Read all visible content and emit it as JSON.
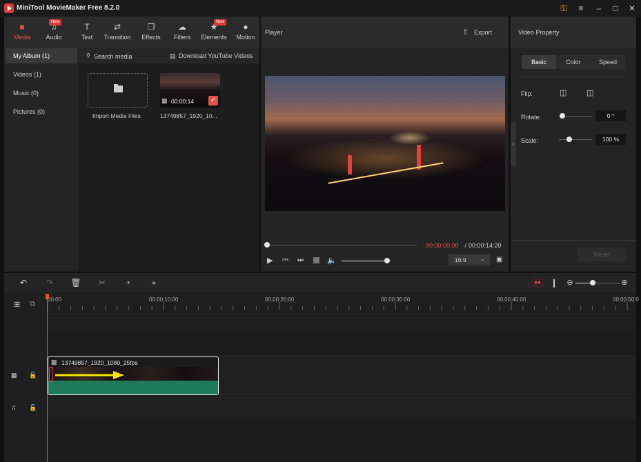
{
  "app": {
    "title": "MiniTool MovieMaker Free 8.2.0"
  },
  "toolbar": {
    "new_badge": "New",
    "tools": [
      {
        "name": "media",
        "label": "Media"
      },
      {
        "name": "audio",
        "label": "Audio"
      },
      {
        "name": "text",
        "label": "Text"
      },
      {
        "name": "transition",
        "label": "Transition"
      },
      {
        "name": "effects",
        "label": "Effects"
      },
      {
        "name": "filters",
        "label": "Filters"
      },
      {
        "name": "elements",
        "label": "Elements"
      },
      {
        "name": "motion",
        "label": "Motion"
      }
    ]
  },
  "album": {
    "items": [
      {
        "label": "My Album (1)"
      },
      {
        "label": "Videos (1)"
      },
      {
        "label": "Music (0)"
      },
      {
        "label": "Pictures (0)"
      }
    ]
  },
  "media": {
    "search_label": "Search media",
    "download_label": "Download YouTube Videos",
    "import_label": "Import Media Files",
    "clip_duration": "00:00:14",
    "clip_name": "13749857_1920_10..."
  },
  "player": {
    "title": "Player",
    "export_label": "Export",
    "current_time": "00:00:00:00",
    "separator": " / ",
    "total_time": "00:00:14:20",
    "aspect_ratio": "16:9",
    "progress_fraction": 0,
    "volume_fraction": 1.0
  },
  "property": {
    "title": "Video Property",
    "tabs": [
      "Basic",
      "Color",
      "Speed"
    ],
    "flip_label": "Flip:",
    "rotate_label": "Rotate:",
    "rotate_value": "0 °",
    "scale_label": "Scale:",
    "scale_value": "100 %",
    "reset_label": "Reset"
  },
  "timeline": {
    "ticks": [
      "00:00",
      "00:00:10:00",
      "00:00:20:00",
      "00:00:30:00",
      "00:00:40:00",
      "00:00:50:0"
    ],
    "clip_name": "13749857_1920_1080_25fps"
  },
  "colors": {
    "accent": "#e3524a",
    "audio_track": "#1f7a5c",
    "arrow": "#f5e600"
  },
  "icons": [
    "film-icon",
    "check-icon",
    "play-icon",
    "volume-icon",
    "undo-icon",
    "redo-icon",
    "trash-icon",
    "scissors-icon",
    "speed-icon",
    "crop-icon",
    "lock-icon",
    "music-icon"
  ]
}
